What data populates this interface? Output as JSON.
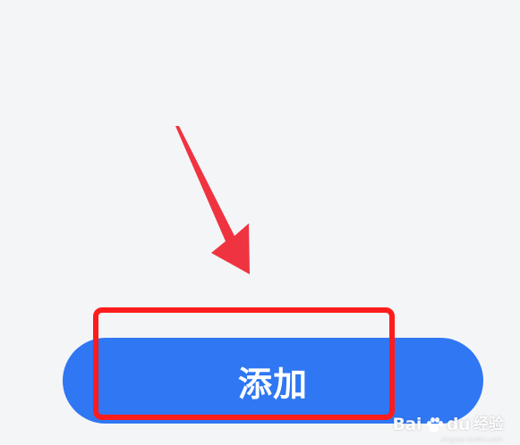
{
  "button": {
    "add_label": "添加"
  },
  "annotation": {
    "arrow_color": "#ef3340",
    "box_color": "#ff1c1c"
  },
  "watermark": {
    "brand": "Bai",
    "brand_suffix": "du",
    "cn": "经验",
    "url": "jingyan.baidu.com"
  },
  "colors": {
    "background": "#f4f5f7",
    "button_blue": "#2f77f3"
  }
}
